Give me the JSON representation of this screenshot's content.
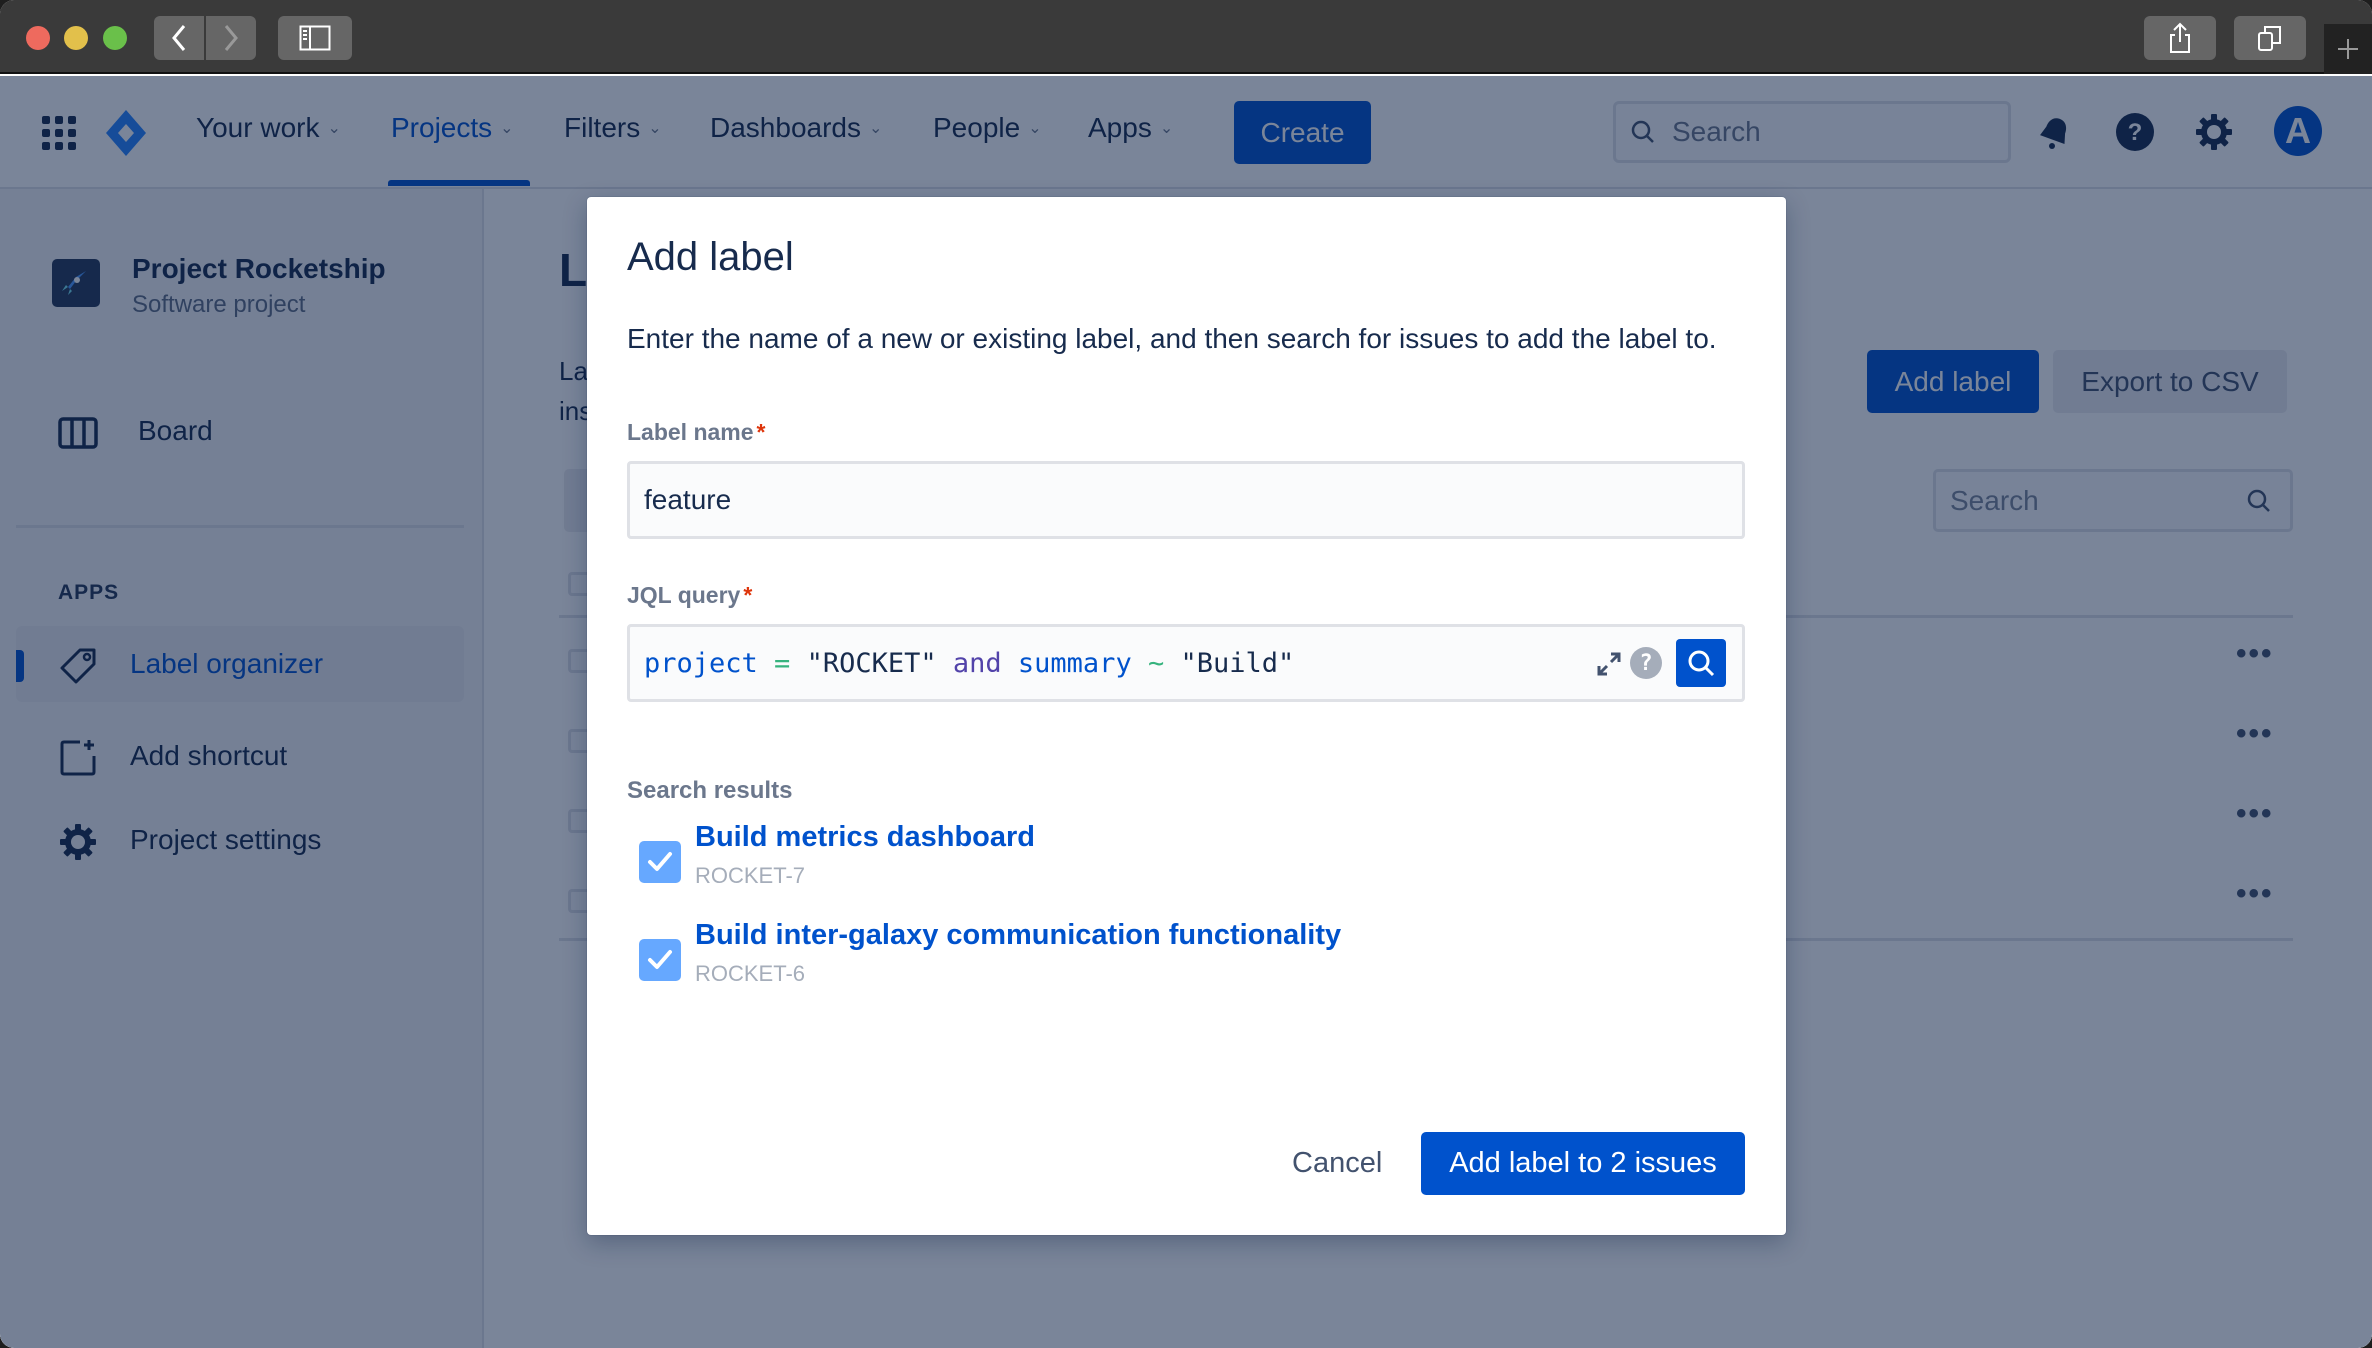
{
  "browser": {
    "back_icon": "chevron-left-icon",
    "forward_icon": "chevron-right-icon",
    "sidebar_icon": "sidebar-toggle-icon",
    "share_icon": "share-icon",
    "tabs_icon": "tabs-overview-icon",
    "new_tab_icon": "plus-icon"
  },
  "topnav": {
    "items": [
      {
        "label": "Your work",
        "active": false
      },
      {
        "label": "Projects",
        "active": true
      },
      {
        "label": "Filters",
        "active": false
      },
      {
        "label": "Dashboards",
        "active": false
      },
      {
        "label": "People",
        "active": false
      },
      {
        "label": "Apps",
        "active": false
      }
    ],
    "create_label": "Create",
    "search_placeholder": "Search",
    "avatar_initial": "A"
  },
  "sidebar": {
    "project_name": "Project Rocketship",
    "project_type": "Software project",
    "board_label": "Board",
    "apps_heading": "APPS",
    "items": [
      {
        "label": "Label organizer",
        "active": true
      },
      {
        "label": "Add shortcut",
        "active": false
      },
      {
        "label": "Project settings",
        "active": false
      }
    ]
  },
  "main": {
    "title_partial": "L",
    "desc_partial_line1": "La",
    "desc_partial_line2": "ins",
    "add_label_button": "Add label",
    "export_button": "Export to CSV",
    "search_placeholder": "Search",
    "row_actions": [
      "•••",
      "•••",
      "•••",
      "•••"
    ]
  },
  "modal": {
    "title": "Add label",
    "description": "Enter the name of a new or existing label, and then search for issues to add the label to.",
    "label_name_label": "Label name",
    "label_name_value": "feature",
    "jql_label": "JQL query",
    "required_marker": "*",
    "jql": {
      "field1": "project",
      "op1": " = ",
      "value1": "\"ROCKET\"",
      "keyword": " and ",
      "field2": "summary",
      "op2": " ~ ",
      "value2": "\"Build\""
    },
    "jql_help": "?",
    "search_results_heading": "Search results",
    "results": [
      {
        "title": "Build metrics dashboard",
        "key": "ROCKET-7",
        "checked": true
      },
      {
        "title": "Build inter-galaxy communication functionality",
        "key": "ROCKET-6",
        "checked": true
      }
    ],
    "cancel_label": "Cancel",
    "submit_label": "Add label to 2 issues"
  },
  "colors": {
    "brand_blue": "#0052CC",
    "overlay": "#091E42",
    "required": "#DE350B",
    "checkbox": "#4C9AFF"
  }
}
